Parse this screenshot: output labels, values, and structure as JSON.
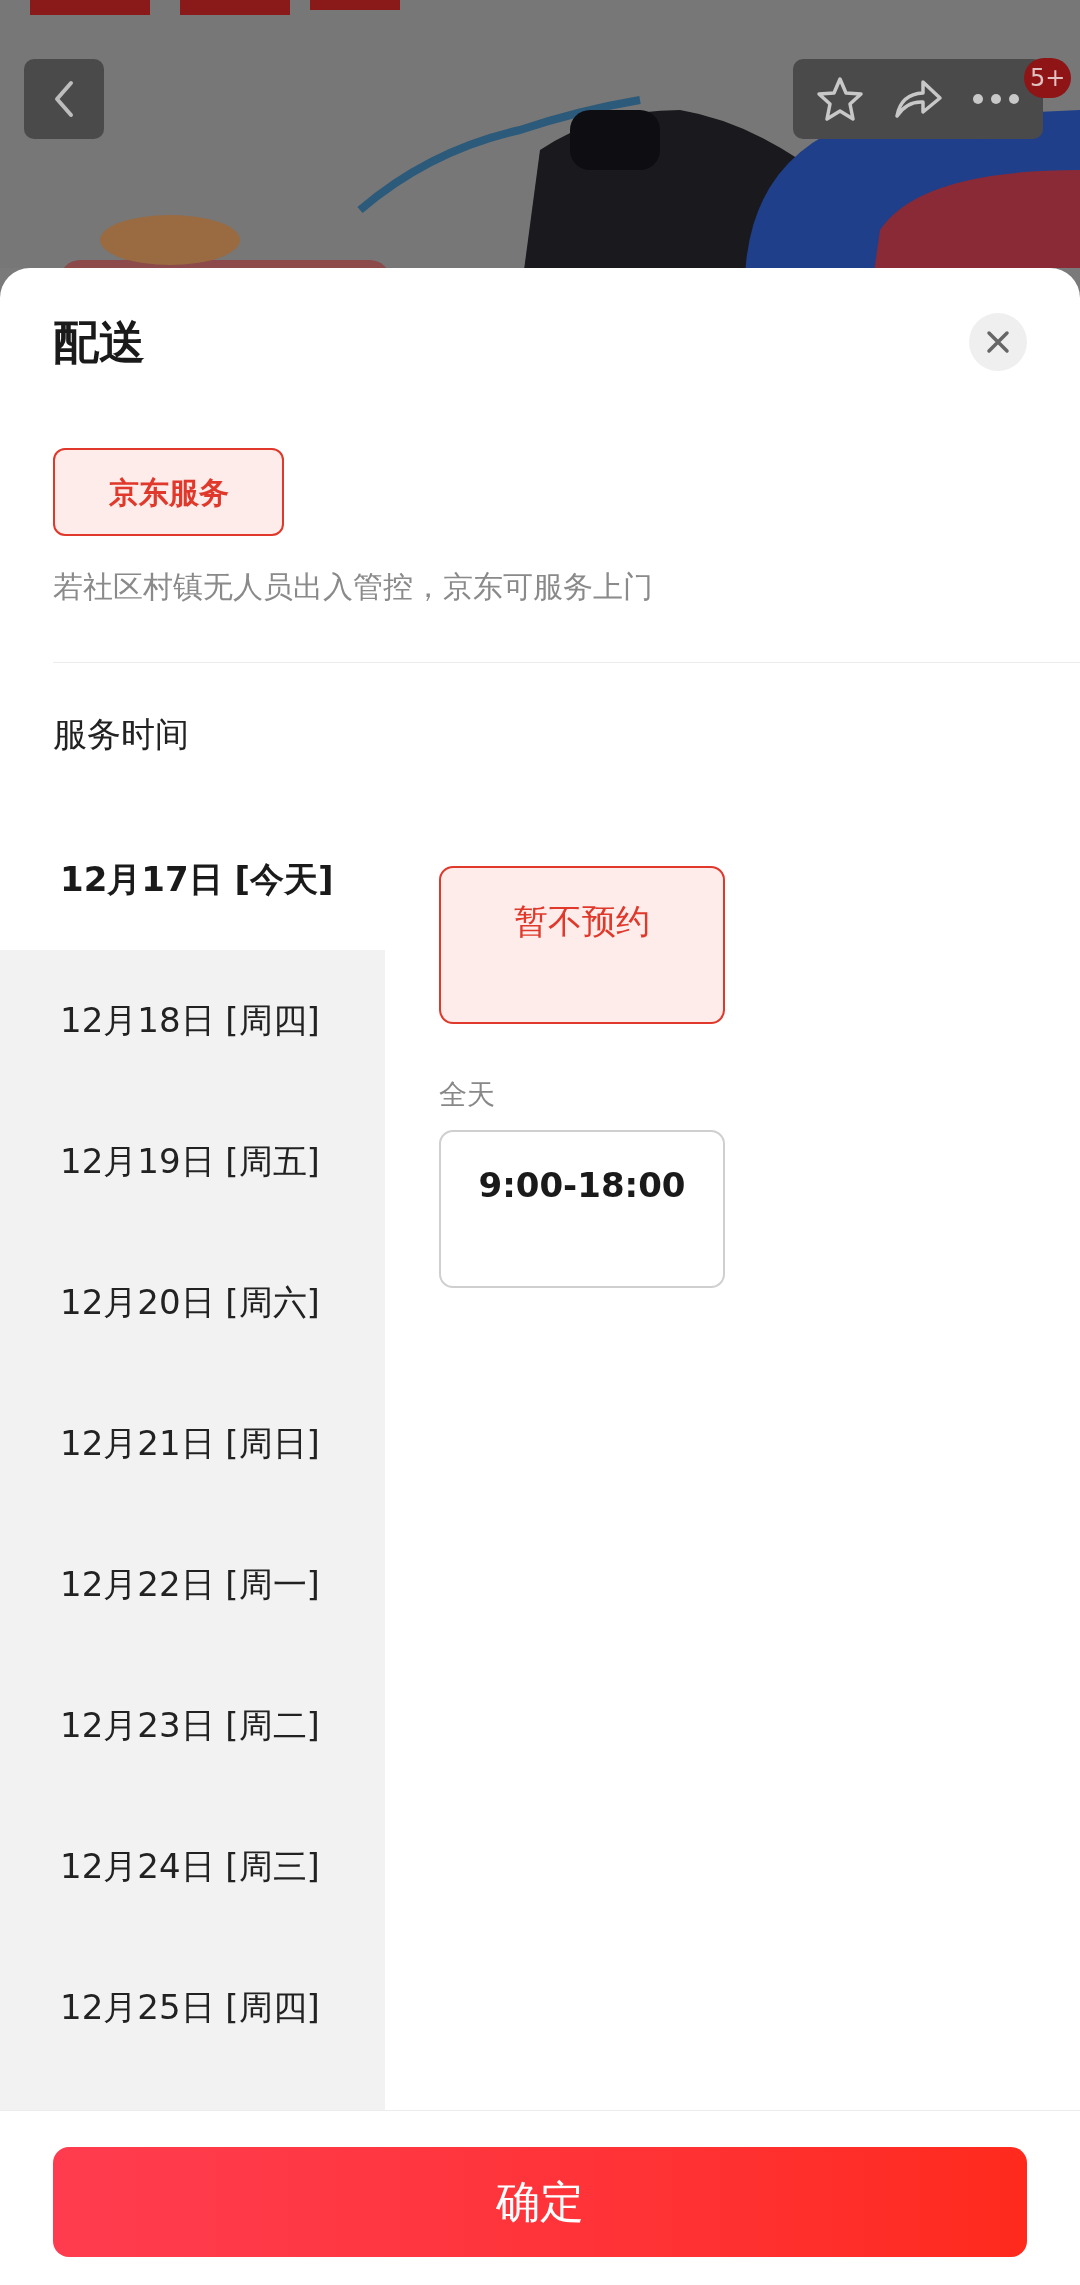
{
  "header": {
    "badge": "5+"
  },
  "sheet": {
    "title": "配送",
    "service_tags": [
      {
        "label": "京东服务",
        "selected": true
      }
    ],
    "note": "若社区村镇无人员出入管控，京东可服务上门",
    "section_title": "服务时间",
    "dates": [
      {
        "label": "12月17日 [今天]",
        "selected": true
      },
      {
        "label": "12月18日 [周四]",
        "selected": false
      },
      {
        "label": "12月19日 [周五]",
        "selected": false
      },
      {
        "label": "12月20日 [周六]",
        "selected": false
      },
      {
        "label": "12月21日 [周日]",
        "selected": false
      },
      {
        "label": "12月22日 [周一]",
        "selected": false
      },
      {
        "label": "12月23日 [周二]",
        "selected": false
      },
      {
        "label": "12月24日 [周三]",
        "selected": false
      },
      {
        "label": "12月25日 [周四]",
        "selected": false
      }
    ],
    "slot_groups": [
      {
        "slots": [
          {
            "label": "暂不预约",
            "selected": true
          }
        ]
      },
      {
        "title": "全天",
        "slots": [
          {
            "label": "9:00-18:00",
            "selected": false
          }
        ]
      }
    ],
    "confirm_button": "确定"
  }
}
